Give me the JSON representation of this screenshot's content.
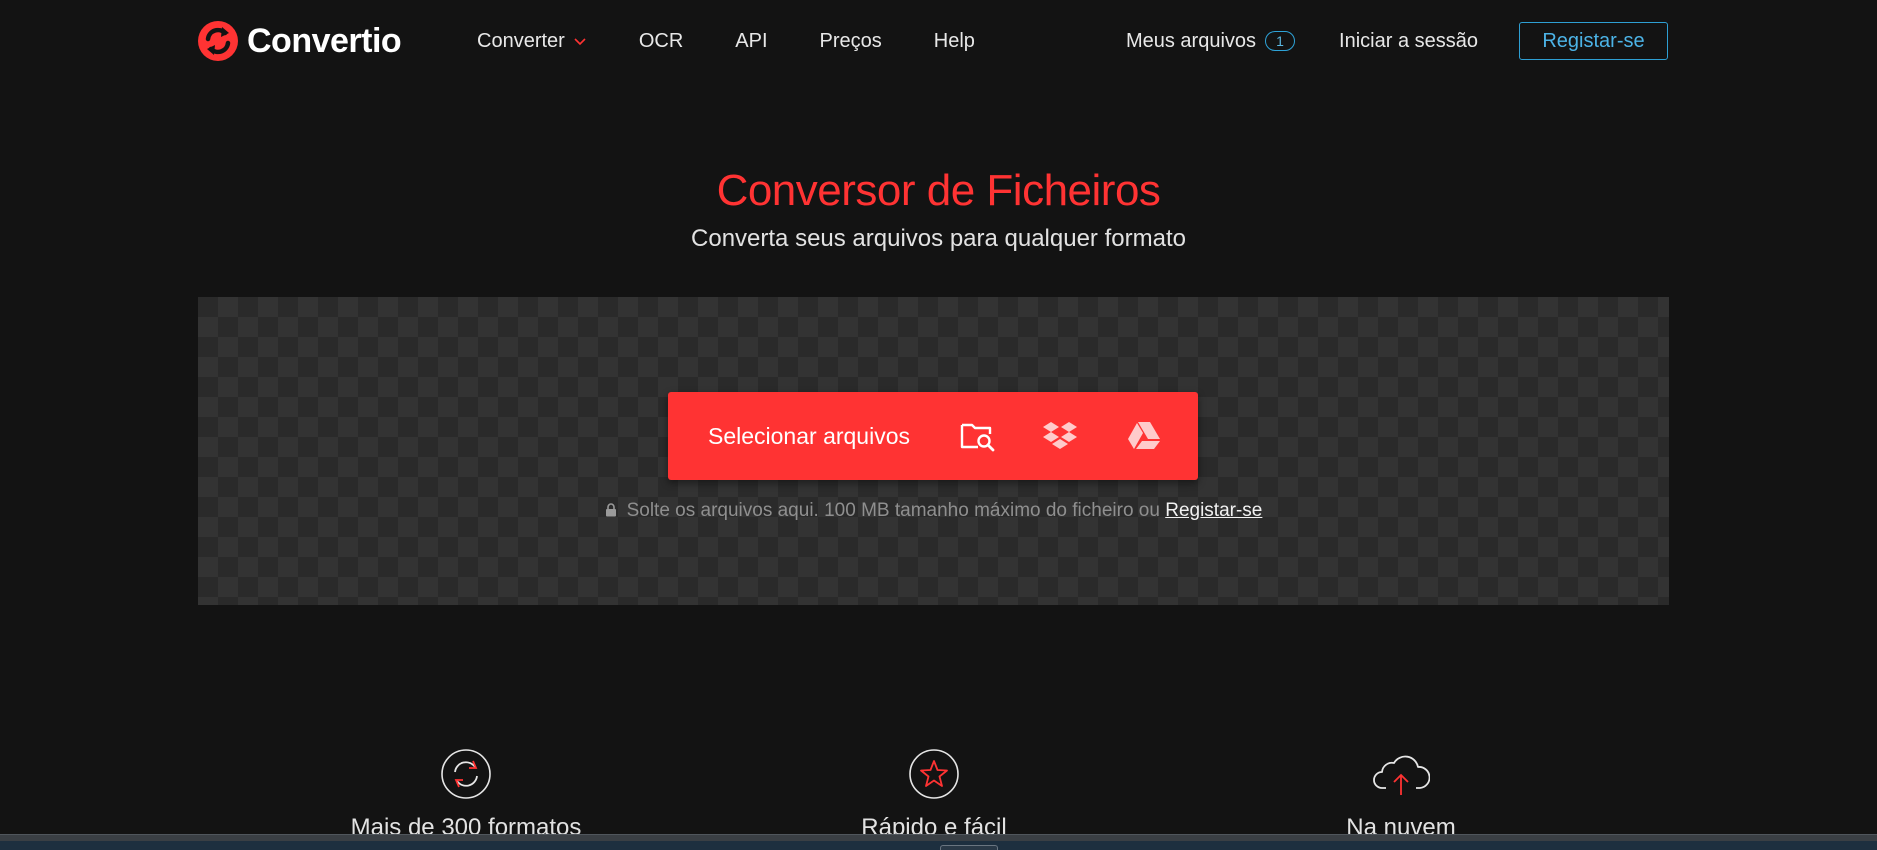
{
  "brand": {
    "name": "Convertio",
    "accent": "#ff3333",
    "link_color": "#2ea3d8"
  },
  "header": {
    "nav": [
      {
        "label": "Converter",
        "has_dropdown": true
      },
      {
        "label": "OCR"
      },
      {
        "label": "API"
      },
      {
        "label": "Preços"
      },
      {
        "label": "Help"
      }
    ],
    "my_files": {
      "label": "Meus arquivos",
      "count": "1"
    },
    "login_label": "Iniciar a sessão",
    "register_label": "Registar-se"
  },
  "hero": {
    "title": "Conversor de Ficheiros",
    "subtitle": "Converta seus arquivos para qualquer formato"
  },
  "upload": {
    "select_label": "Selecionar arquivos",
    "sources": [
      "folder-search-icon",
      "dropbox-icon",
      "google-drive-icon"
    ],
    "hint_text": "Solte os arquivos aqui. 100 MB tamanho máximo do ficheiro ou",
    "hint_link": "Registar-se"
  },
  "features": [
    {
      "icon": "refresh-circle-icon",
      "title": "Mais de 300 formatos"
    },
    {
      "icon": "star-circle-icon",
      "title": "Rápido e fácil"
    },
    {
      "icon": "cloud-upload-icon",
      "title": "Na nuvem"
    }
  ]
}
